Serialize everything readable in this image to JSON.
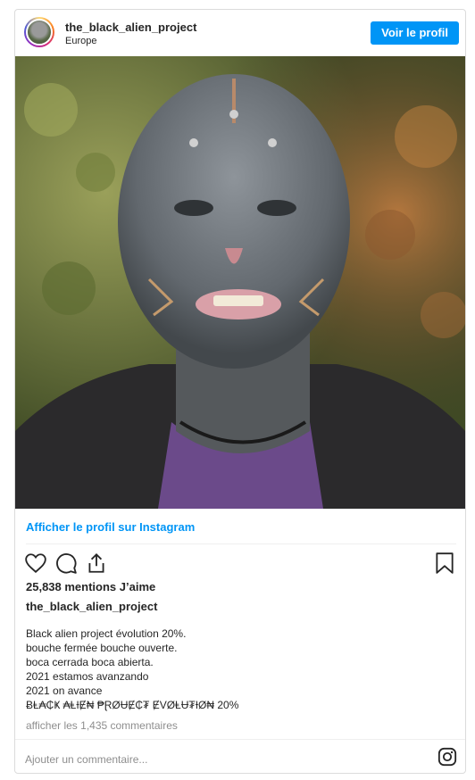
{
  "header": {
    "username": "the_black_alien_project",
    "location": "Europe",
    "profile_button": "Voir le profil"
  },
  "photo": {
    "description_icon": "portrait-photo"
  },
  "view_on_instagram": "Afficher le profil sur Instagram",
  "actions": {
    "like_icon": "heart-icon",
    "comment_icon": "comment-icon",
    "share_icon": "share-icon",
    "save_icon": "bookmark-icon"
  },
  "likes": "25,838 mentions J’aime",
  "caption": {
    "username": "the_black_alien_project",
    "lines": [
      "Black alien project évolution 20%.",
      "bouche fermée bouche ouverte.",
      "boca cerrada boca abierta.",
      "2021 estamos avanzando",
      "2021 on avance",
      "ɃⱠ₳₵Ҝ ₳ⱠƗɆ₦ ₱ⱤØɄɆ₵₮ ɆVØⱠɄ₮ƗØ₦ 20%"
    ]
  },
  "comments_link": "afficher les 1,435 commentaires",
  "comment_placeholder": "Ajouter un commentaire...",
  "colors": {
    "accent": "#0095f6",
    "text": "#262626",
    "muted": "#8e8e8e",
    "border": "#dbdbdb"
  }
}
